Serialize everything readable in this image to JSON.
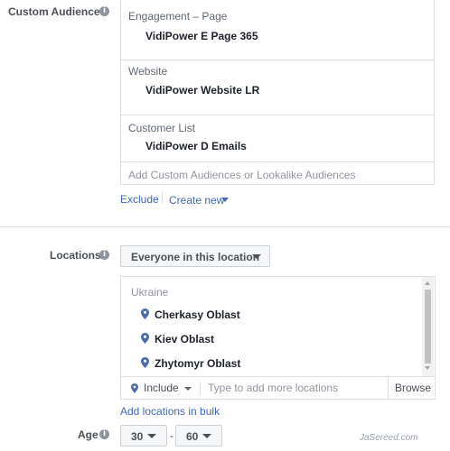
{
  "custom_audiences": {
    "label": "Custom Audiences",
    "sections": [
      {
        "title": "Engagement – Page",
        "item": "VidiPower E Page 365"
      },
      {
        "title": "Website",
        "item": "VidiPower Website LR"
      },
      {
        "title": "Customer List",
        "item": "VidiPower D Emails"
      }
    ],
    "placeholder": "Add Custom Audiences or Lookalike Audiences",
    "exclude_label": "Exclude",
    "create_new_label": "Create new"
  },
  "locations": {
    "label": "Locations",
    "dropdown_value": "Everyone in this location",
    "country": "Ukraine",
    "items": [
      "Cherkasy Oblast",
      "Kiev Oblast",
      "Zhytomyr Oblast"
    ],
    "include_label": "Include",
    "search_placeholder": "Type to add more locations",
    "browse_label": "Browse",
    "bulk_link": "Add locations in bulk"
  },
  "age": {
    "label": "Age",
    "min": "30",
    "max": "60",
    "separator": "-"
  },
  "info_glyph": "i",
  "colors": {
    "link": "#4267b2",
    "pin": "#4a6aa8"
  },
  "watermark": "JaSereed.com"
}
